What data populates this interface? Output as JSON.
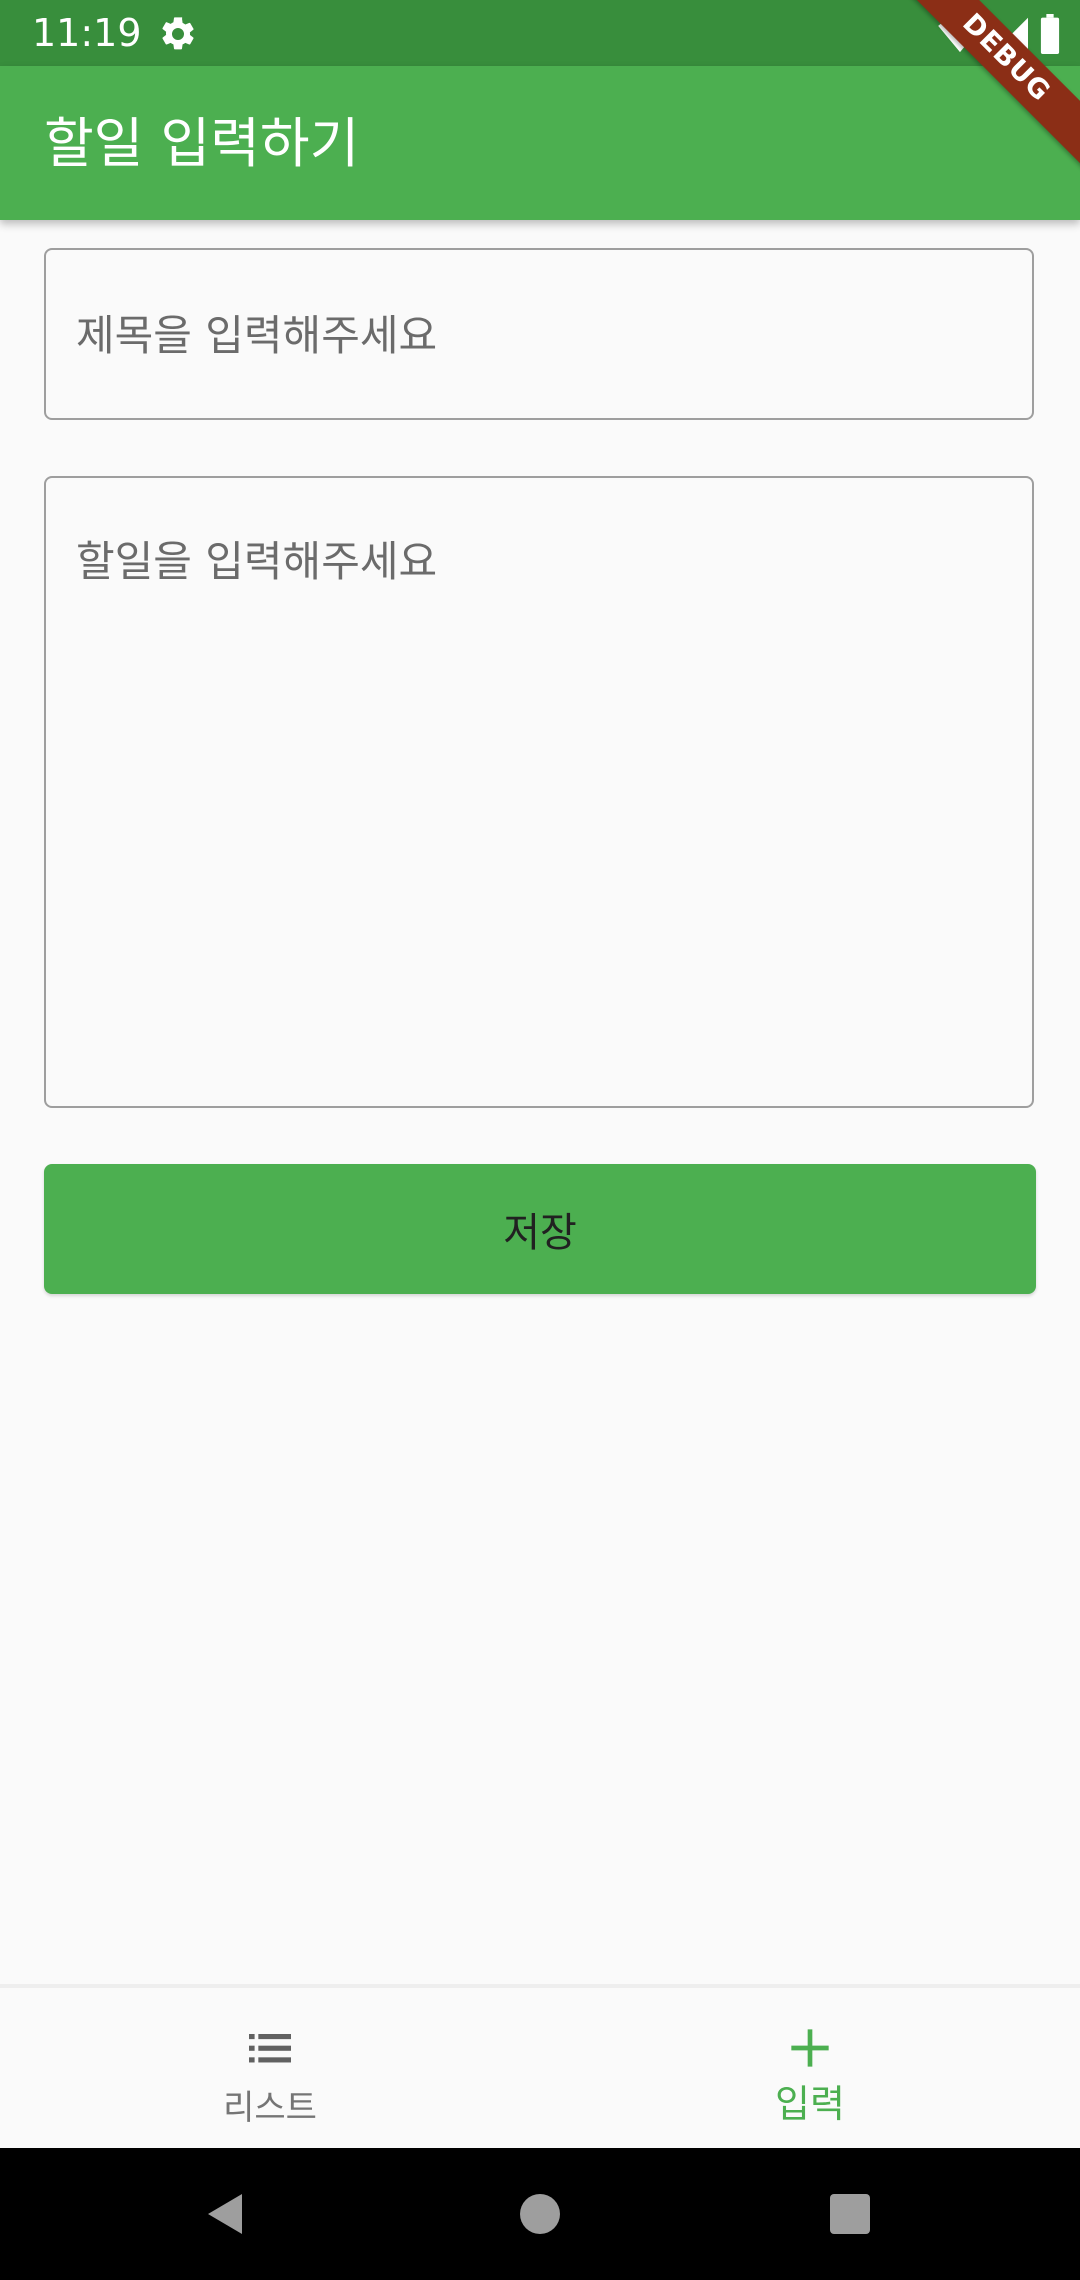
{
  "status_bar": {
    "time": "11:19",
    "icons": [
      "settings-gear-icon",
      "wifi-icon",
      "cell-signal-icon",
      "battery-icon"
    ]
  },
  "debug_banner": {
    "label": "DEBUG"
  },
  "app_bar": {
    "title": "할일 입력하기"
  },
  "form": {
    "title_field": {
      "value": "",
      "placeholder": "제목을 입력해주세요"
    },
    "todo_field": {
      "value": "",
      "placeholder": "할일을 입력해주세요"
    },
    "save_label": "저장"
  },
  "bottom_nav": {
    "items": [
      {
        "label": "리스트",
        "icon": "list-icon",
        "selected": false
      },
      {
        "label": "입력",
        "icon": "add-icon",
        "selected": true
      }
    ]
  },
  "system_nav": {
    "buttons": [
      "back-icon",
      "home-icon",
      "recents-icon"
    ]
  },
  "colors": {
    "status_bar": "#388e3c",
    "primary": "#4caf50",
    "background": "#fafafa",
    "debug_ribbon": "#8b2e16",
    "inactive": "#757575"
  }
}
